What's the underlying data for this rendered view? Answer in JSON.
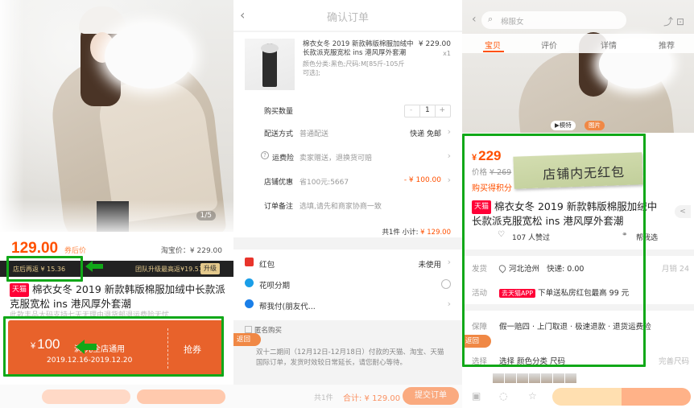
{
  "panel1": {
    "image_counter": "1/5",
    "price": "129.00",
    "price_after_coupon": "券后价",
    "taobao_price": "淘宝价：¥ 229.00",
    "dark_bar": {
      "left": "店后再返 ¥ 15.36",
      "right": "团队升级最高返¥19.51",
      "button": "升级"
    },
    "title_badge": "天猫",
    "title": "棉衣女冬 2019 新款韩版棉服加绒中长款派克服宽松 ins 港风厚外套潮",
    "subtitle": "此款丰品大码支持七天无理由退货邮退运费险无忧",
    "coupon": {
      "currency": "¥",
      "amount": "100",
      "condition": "满 元全店通用",
      "dates": "2019.12.16-2019.12.20",
      "button": "抢券"
    }
  },
  "panel2": {
    "back": "‹",
    "title": "确认订单",
    "item": {
      "title": "棉衣女冬 2019 新款韩版棉服加绒中长款派克服宽松 ins 港风厚外套潮",
      "spec": "颜色分类:黑色;尺码:M[85斤-105斤可选];",
      "price": "¥ 229.00",
      "qty": "x1"
    },
    "rows": {
      "quantity_label": "购买数量",
      "quantity_minus": "-",
      "quantity_value": "1",
      "quantity_plus": "+",
      "delivery_label": "配送方式",
      "delivery_value": "普通配送",
      "delivery_right": "快递 免邮",
      "insurance_label": "运费险",
      "insurance_value": "卖家赠送，退换货可赔",
      "shop_discount_label": "店铺优惠",
      "shop_discount_value": "省100元:5667",
      "shop_discount_right": "- ¥ 100.00",
      "remark_label": "订单备注",
      "remark_placeholder": "选填,请先和商家协商一致"
    },
    "subtotal": {
      "count": "共1件",
      "label": "小计:",
      "amount": "¥ 129.00"
    },
    "payment": {
      "hongbao_label": "红包",
      "hongbao_right": "未使用",
      "huabei_label": "花呗分期",
      "friend_pay_label": "帮我付(朋友代..."
    },
    "anonymous": "匿名购买",
    "return_tab": "返回",
    "notice": "双十二期间（12月12日-12月18日）付款的天猫、淘宝、天猫国际订单，发货时效较日常延长，请您耐心等待。",
    "bottom": {
      "count": "共1件",
      "total": "合计: ¥ 129.00",
      "button": "提交订单"
    }
  },
  "panel3": {
    "search_placeholder": "棉服女",
    "tabs": [
      "宝贝",
      "评价",
      "详情",
      "推荐"
    ],
    "media": [
      "▶模特",
      "图片"
    ],
    "currency": "¥",
    "price": "229",
    "original_label": "价格",
    "original_price": "¥ 269",
    "points": "购买得积分",
    "sticker_text": "店铺内无红包",
    "title_badge": "天猫",
    "title": "棉衣女冬 2019 新款韩版棉服加绒中长款派克服宽松 ins 港风厚外套潮",
    "likes": "107 人赞过",
    "help_pick": "帮我选",
    "ship_label": "发货",
    "ship_location": "河北沧州",
    "ship_fee": "快递: 0.00",
    "ship_right": "月销 24",
    "activity_label": "活动",
    "activity_badge": "去天猫APP",
    "activity_text": "下单送私房红包最高 99 元",
    "guarantee_label": "保障",
    "guarantee_text": "假一赔四 · 上门取退 · 极速退款 · 退货运费险",
    "return_tab": "返回",
    "select_label": "选择",
    "select_text": "选择 颜色分类 尺码",
    "select_right": "完善尺码"
  }
}
